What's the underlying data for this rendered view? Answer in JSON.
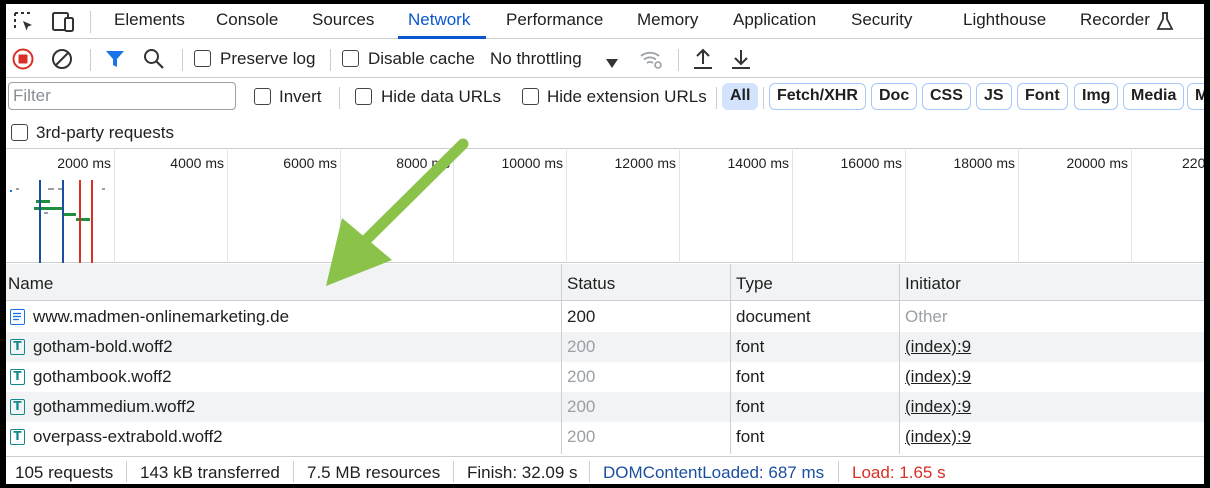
{
  "tabs": [
    {
      "label": "Elements",
      "active": false
    },
    {
      "label": "Console",
      "active": false
    },
    {
      "label": "Sources",
      "active": false
    },
    {
      "label": "Network",
      "active": true
    },
    {
      "label": "Performance",
      "active": false
    },
    {
      "label": "Memory",
      "active": false
    },
    {
      "label": "Application",
      "active": false
    },
    {
      "label": "Security",
      "active": false
    },
    {
      "label": "Lighthouse",
      "active": false
    },
    {
      "label": "Recorder",
      "active": false
    }
  ],
  "toolbar": {
    "preserve_log": "Preserve log",
    "disable_cache": "Disable cache",
    "throttling": "No throttling"
  },
  "filter": {
    "placeholder": "Filter",
    "invert": "Invert",
    "hide_data_urls": "Hide data URLs",
    "hide_extension_urls": "Hide extension URLs",
    "types": [
      "All",
      "Fetch/XHR",
      "Doc",
      "CSS",
      "JS",
      "Font",
      "Img",
      "Media",
      "M"
    ],
    "third_party": "3rd-party requests"
  },
  "overview": {
    "ticks": [
      "2000 ms",
      "4000 ms",
      "6000 ms",
      "8000 ms",
      "10000 ms",
      "12000 ms",
      "14000 ms",
      "16000 ms",
      "18000 ms",
      "20000 ms",
      "220"
    ]
  },
  "table": {
    "columns": [
      "Name",
      "Status",
      "Type",
      "Initiator"
    ],
    "rows": [
      {
        "name": "www.madmen-onlinemarketing.de",
        "status": "200",
        "type": "document",
        "initiator": "Other",
        "icon": "document-icon"
      },
      {
        "name": "gotham-bold.woff2",
        "status": "200",
        "type": "font",
        "initiator": "(index):9",
        "icon": "font-icon"
      },
      {
        "name": "gothambook.woff2",
        "status": "200",
        "type": "font",
        "initiator": "(index):9",
        "icon": "font-icon"
      },
      {
        "name": "gothammedium.woff2",
        "status": "200",
        "type": "font",
        "initiator": "(index):9",
        "icon": "font-icon"
      },
      {
        "name": "overpass-extrabold.woff2",
        "status": "200",
        "type": "font",
        "initiator": "(index):9",
        "icon": "font-icon"
      }
    ],
    "font_icon_glyph": "T"
  },
  "status": {
    "requests": "105 requests",
    "transferred": "143 kB transferred",
    "resources": "7.5 MB resources",
    "finish": "Finish: 32.09 s",
    "dcl": "DOMContentLoaded: 687 ms",
    "load": "Load: 1.65 s"
  },
  "colors": {
    "accent": "#0b57d0",
    "record": "#d93025",
    "filter_icon": "#1a73e8",
    "arrow": "#8bc34a",
    "dcl": "#1a4fa0",
    "load": "#d93025"
  }
}
